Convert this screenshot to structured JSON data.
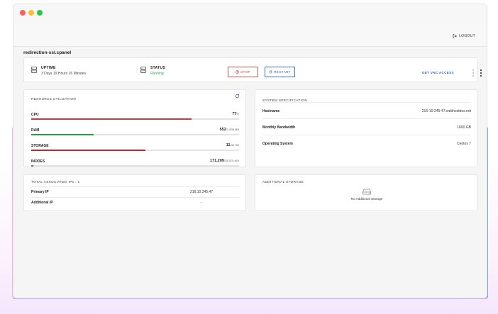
{
  "window": {
    "controls": [
      "close",
      "minimize",
      "maximize"
    ]
  },
  "topbar": {
    "logout_label": "LOGOUT",
    "logout_icon": "logout-icon"
  },
  "server": {
    "hostname": "redirection-ssl.cpanel"
  },
  "status_bar": {
    "uptime_title": "UPTIME",
    "uptime_value": "3 Days 19 Hours 16 Minutes",
    "status_title": "STATUS",
    "status_value": "Running",
    "stop_label": "STOP",
    "restart_label": "RESTART",
    "vnc_label": "GET VNC ACCESS"
  },
  "resources": {
    "title": "RESOURCE UTILIZATION",
    "items": [
      {
        "label": "CPU",
        "value": "77",
        "unit": "%",
        "fraction": 0.77,
        "color": "#d0393e"
      },
      {
        "label": "RAM",
        "value": "552",
        "unit": "/1,838 MB",
        "fraction": 0.3,
        "color": "#2e9b45"
      },
      {
        "label": "STORAGE",
        "value": "11",
        "unit": "/30 GB",
        "fraction": 0.55,
        "color": "#b22a34"
      },
      {
        "label": "INODES",
        "value": "171,209",
        "unit": "/28,870,464",
        "fraction": 0.01,
        "color": "#2e9b45"
      }
    ]
  },
  "spec": {
    "title": "SYSTEM SPECIFICATION",
    "rows": [
      {
        "key": "Hostname",
        "value": "216-10-245-47.webhostbox.net"
      },
      {
        "key": "Monthly Bandwidth",
        "value": "1600 GB"
      },
      {
        "key": "Operating System",
        "value": "Centos 7"
      }
    ]
  },
  "ips": {
    "title": "TOTAL ASSOCIATED IPs : 1",
    "rows": [
      {
        "key": "Primary IP",
        "value": "216.10.245.47"
      },
      {
        "key": "Additional IP",
        "value": "-"
      }
    ]
  },
  "storage": {
    "title": "ADDITIONAL STORAGE",
    "empty_text": "No Additional Storage"
  }
}
